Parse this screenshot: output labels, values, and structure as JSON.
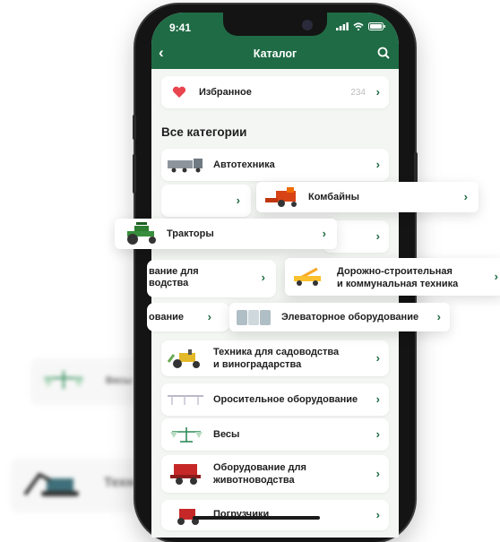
{
  "status": {
    "time": "9:41"
  },
  "nav": {
    "title": "Каталог"
  },
  "favorites": {
    "label": "Избранное",
    "count": "234"
  },
  "section_title": "Все категории",
  "categories": [
    {
      "label_line1": "Автотехника",
      "label_line2": ""
    },
    {
      "label_line1": "Техника для садоводства",
      "label_line2": "и виноградарства"
    },
    {
      "label_line1": "Оросительное оборудование",
      "label_line2": ""
    },
    {
      "label_line1": "Весы",
      "label_line2": ""
    },
    {
      "label_line1": "Оборудование для",
      "label_line2": "животноводства"
    },
    {
      "label_line1": "Погрузчики",
      "label_line2": ""
    }
  ],
  "partial_rows": {
    "left_line1": "вание для",
    "left_line2": "водства",
    "mid": "ование"
  },
  "floating_cards": [
    {
      "label_line1": "Комбайны",
      "label_line2": ""
    },
    {
      "label_line1": "Тракторы",
      "label_line2": ""
    },
    {
      "label_line1": "Дорожно-строительная",
      "label_line2": "и коммунальная техника"
    },
    {
      "label_line1": "Элеваторное оборудование",
      "label_line2": ""
    }
  ],
  "background_labels": {
    "scales": "Весы",
    "tech": "Техн"
  },
  "colors": {
    "primary": "#1f6b45",
    "heart": "#e8454f",
    "text": "#1e1e1e",
    "muted": "#bdbdbd"
  }
}
